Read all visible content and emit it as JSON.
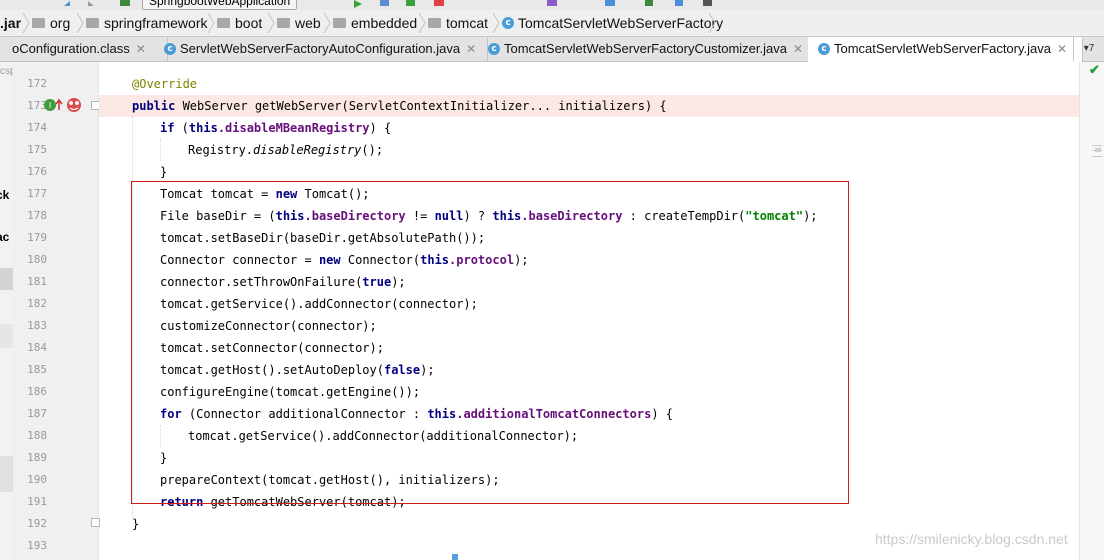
{
  "toolbar": {
    "run_config": "SpringbootWebApplication"
  },
  "breadcrumb": {
    "jar": ".jar",
    "items": [
      {
        "label": "org"
      },
      {
        "label": "springframework"
      },
      {
        "label": "boot"
      },
      {
        "label": "web"
      },
      {
        "label": "embedded"
      },
      {
        "label": "tomcat"
      }
    ],
    "class_label": "TomcatServletWebServerFactory"
  },
  "tabs": [
    {
      "label": "oConfiguration.class",
      "active": false
    },
    {
      "label": "ServletWebServerFactoryAutoConfiguration.java",
      "active": false
    },
    {
      "label": "TomcatServletWebServerFactoryCustomizer.java",
      "active": false
    },
    {
      "label": "TomcatServletWebServerFactory.java",
      "active": true
    }
  ],
  "tab_overflow": "▾7",
  "side_panel": {
    "labels": [
      "csp",
      "ck",
      "ac"
    ]
  },
  "editor": {
    "line_numbers": [
      "172",
      "173",
      "174",
      "175",
      "176",
      "177",
      "178",
      "179",
      "180",
      "181",
      "182",
      "183",
      "184",
      "185",
      "186",
      "187",
      "188",
      "189",
      "190",
      "191",
      "192",
      "193"
    ],
    "code": {
      "l172": {
        "ann": "@Override"
      },
      "l173": {
        "kw": "public",
        "rest": " WebServer getWebServer(ServletContextInitializer... initializers) {"
      },
      "l174": {
        "kw": "if",
        "a": " (",
        "kw2": "this",
        "fld": ".disableMBeanRegistry",
        "b": ") {"
      },
      "l175": {
        "a": "Registry.",
        "it": "disableRegistry",
        "b": "();"
      },
      "l176": {
        "a": "}"
      },
      "l177": {
        "a": "Tomcat tomcat = ",
        "kw": "new",
        "b": " Tomcat();"
      },
      "l178": {
        "a": "File baseDir = (",
        "kw": "this",
        "fld": ".baseDirectory",
        "b": " != ",
        "kw2": "null",
        "c": ") ? ",
        "kw3": "this",
        "fld2": ".baseDirectory",
        "d": " : createTempDir(",
        "str": "\"tomcat\"",
        "e": ");"
      },
      "l179": {
        "a": "tomcat.setBaseDir(baseDir.getAbsolutePath());"
      },
      "l180": {
        "a": "Connector connector = ",
        "kw": "new",
        "b": " Connector(",
        "kw2": "this",
        "fld": ".protocol",
        "c": ");"
      },
      "l181": {
        "a": "connector.setThrowOnFailure(",
        "kw": "true",
        "b": ");"
      },
      "l182": {
        "a": "tomcat.getService().addConnector(connector);"
      },
      "l183": {
        "a": "customizeConnector(connector);"
      },
      "l184": {
        "a": "tomcat.setConnector(connector);"
      },
      "l185": {
        "a": "tomcat.getHost().setAutoDeploy(",
        "kw": "false",
        "b": ");"
      },
      "l186": {
        "a": "configureEngine(tomcat.getEngine());"
      },
      "l187": {
        "kw": "for",
        "a": " (Connector additionalConnector : ",
        "kw2": "this",
        "fld": ".additionalTomcatConnectors",
        "b": ") {"
      },
      "l188": {
        "a": "tomcat.getService().addConnector(additionalConnector);"
      },
      "l189": {
        "a": "}"
      },
      "l190": {
        "a": "prepareContext(tomcat.getHost(), initializers);"
      },
      "l191": {
        "kw": "return",
        "a": " getTomcatWebServer(tomcat);"
      },
      "l192": {
        "a": "}"
      }
    }
  },
  "colors": {
    "highlight_box": "#d11a1a",
    "keyword": "#000080",
    "field": "#660e7a",
    "annotation": "#808000",
    "string": "#008000"
  },
  "watermark": "https://smilenicky.blog.csdn.net"
}
